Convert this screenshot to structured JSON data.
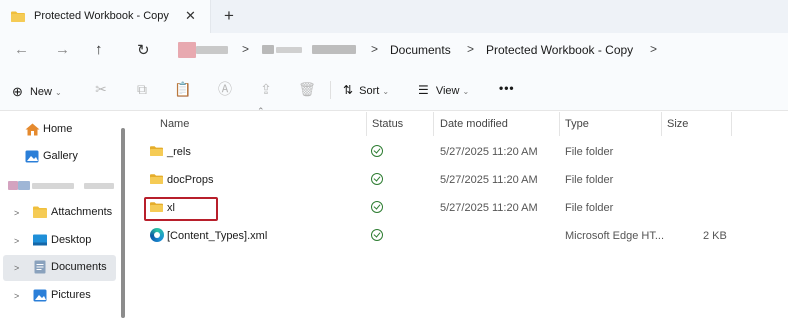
{
  "tab": {
    "title": "Protected Workbook - Copy",
    "close": "✕",
    "new_tab": "+"
  },
  "nav": {
    "back": "←",
    "forward": "→",
    "up": "↑",
    "refresh": "↻"
  },
  "breadcrumb": {
    "separator": ">",
    "items": [
      "Documents",
      "Protected Workbook - Copy"
    ]
  },
  "toolbar": {
    "new_label": "New",
    "sort_label": "Sort",
    "view_label": "View",
    "more_label": "•••",
    "new_icon": "⊕",
    "sort_icon": "⇅",
    "view_icon": "☰"
  },
  "sidebar": {
    "items": [
      {
        "label": "Home",
        "icon": "home-icon"
      },
      {
        "label": "Gallery",
        "icon": "gallery-icon"
      },
      {
        "label": "Attachments",
        "icon": "folder-icon"
      },
      {
        "label": "Desktop",
        "icon": "desktop-icon"
      },
      {
        "label": "Documents",
        "icon": "documents-icon"
      },
      {
        "label": "Pictures",
        "icon": "pictures-icon"
      }
    ],
    "expander": ">"
  },
  "columns": [
    "Name",
    "Status",
    "Date modified",
    "Type",
    "Size"
  ],
  "files": [
    {
      "name": "_rels",
      "date": "5/27/2025 11:20 AM",
      "type": "File folder",
      "size": "",
      "icon": "folder-icon"
    },
    {
      "name": "docProps",
      "date": "5/27/2025 11:20 AM",
      "type": "File folder",
      "size": "",
      "icon": "folder-icon"
    },
    {
      "name": "xl",
      "date": "5/27/2025 11:20 AM",
      "type": "File folder",
      "size": "",
      "icon": "folder-icon"
    },
    {
      "name": "[Content_Types].xml",
      "date": "",
      "type": "Microsoft Edge HT...",
      "size": "2 KB",
      "icon": "edge-icon"
    }
  ],
  "colors": {
    "folder": "#f0bf3c",
    "folder_dark": "#d99b16",
    "status_ok": "#2e7d32",
    "highlight": "#b81f2b",
    "selected_bg": "#e5e8ec"
  }
}
